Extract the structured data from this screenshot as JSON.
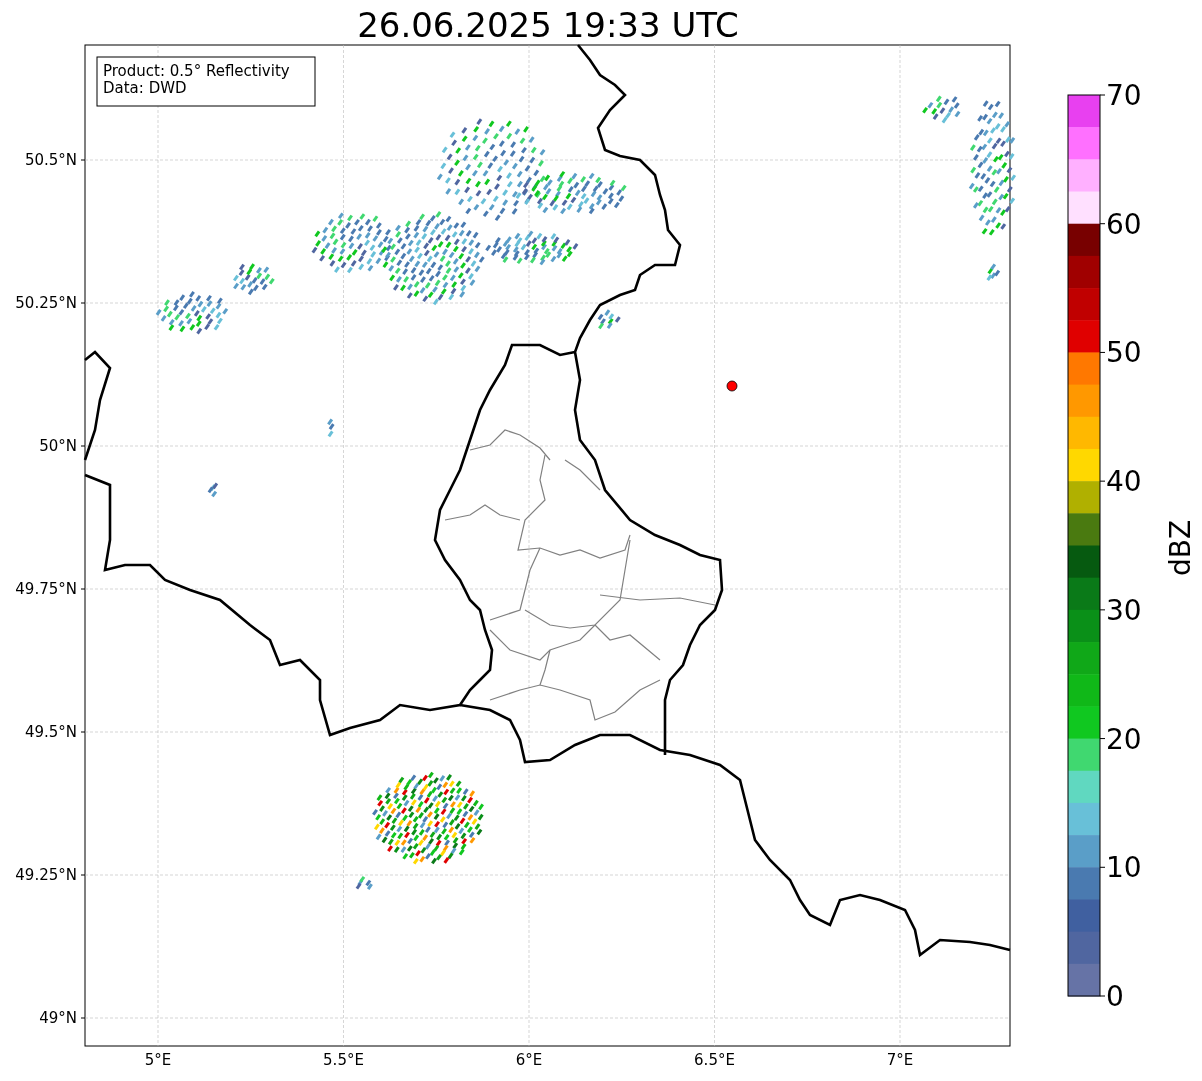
{
  "title": "26.06.2025 19:33 UTC",
  "legend": {
    "lines": [
      "Product: 0.5° Reflectivity",
      "Data: DWD"
    ]
  },
  "map": {
    "lat_labels": [
      "50.5°N",
      "50.25°N",
      "50°N",
      "49.75°N",
      "49.5°N",
      "49.25°N",
      "49°N"
    ],
    "lon_labels": [
      "5°E",
      "5.5°E",
      "6°E",
      "6.5°E",
      "7°E"
    ]
  },
  "colorbar": {
    "label": "dBZ",
    "ticks": [
      "70",
      "60",
      "50",
      "40",
      "30",
      "20",
      "10",
      "0"
    ],
    "bands": [
      {
        "color": "#e840f0"
      },
      {
        "color": "#ff70ff"
      },
      {
        "color": "#ffb0ff"
      },
      {
        "color": "#ffe0ff"
      },
      {
        "color": "#780000"
      },
      {
        "color": "#a00000"
      },
      {
        "color": "#c00000"
      },
      {
        "color": "#e00000"
      },
      {
        "color": "#ff7800"
      },
      {
        "color": "#ff9800"
      },
      {
        "color": "#ffb800"
      },
      {
        "color": "#ffd800"
      },
      {
        "color": "#b0b000"
      },
      {
        "color": "#4a7a10"
      },
      {
        "color": "#065a10"
      },
      {
        "color": "#0a7a18"
      },
      {
        "color": "#0a9018"
      },
      {
        "color": "#10a818"
      },
      {
        "color": "#10b818"
      },
      {
        "color": "#10c820"
      },
      {
        "color": "#40d870"
      },
      {
        "color": "#60d8c0"
      },
      {
        "color": "#68c0d8"
      },
      {
        "color": "#5a9ec8"
      },
      {
        "color": "#4a7ab0"
      },
      {
        "color": "#4060a0"
      },
      {
        "color": "#5066a0"
      },
      {
        "color": "#6673a6"
      }
    ]
  }
}
